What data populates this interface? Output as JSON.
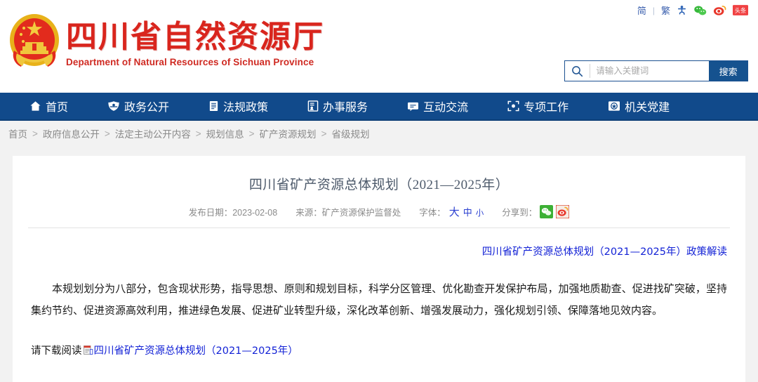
{
  "header": {
    "logo": {
      "emblem_icon": "china-national-emblem-icon",
      "title_cn": "四川省自然资源厅",
      "title_en": "Department of Natural Resources of Sichuan Province"
    },
    "utilities": [
      {
        "name": "lang-simplified",
        "label": "简"
      },
      {
        "name": "lang-separator",
        "label": "|"
      },
      {
        "name": "lang-traditional",
        "label": "繁"
      },
      {
        "name": "accessibility-icon",
        "label": ""
      },
      {
        "name": "wechat-icon",
        "label": ""
      },
      {
        "name": "weibo-icon",
        "label": ""
      },
      {
        "name": "toutiao-icon",
        "label": "头条"
      }
    ],
    "search": {
      "placeholder": "请输入关键词",
      "value": "",
      "button_label": "搜索",
      "icon": "search-icon"
    }
  },
  "nav": {
    "items": [
      {
        "label": "首页",
        "icon": "home-icon"
      },
      {
        "label": "政务公开",
        "icon": "shield-icon"
      },
      {
        "label": "法规政策",
        "icon": "document-icon"
      },
      {
        "label": "办事服务",
        "icon": "service-form-icon"
      },
      {
        "label": "互动交流",
        "icon": "chat-bubble-icon"
      },
      {
        "label": "专项工作",
        "icon": "target-frame-icon"
      },
      {
        "label": "机关党建",
        "icon": "party-badge-icon"
      }
    ]
  },
  "breadcrumb": {
    "separator": ">",
    "items": [
      "首页",
      "政府信息公开",
      "法定主动公开内容",
      "规划信息",
      "矿产资源规划",
      "省级规划"
    ]
  },
  "article": {
    "title": "四川省矿产资源总体规划（2021—2025年）",
    "meta": {
      "date_label": "发布日期：",
      "date_value": "2023-02-08",
      "source_label": "来源：",
      "source_value": "矿产资源保护监督处",
      "font_label": "字体：",
      "font_large": "大",
      "font_medium": "中",
      "font_small": "小",
      "share_label": "分享到：",
      "share_icons": [
        "wechat-share-icon",
        "weibo-share-icon"
      ]
    },
    "interpretation_link": "四川省矿产资源总体规划（2021—2025年）政策解读",
    "paragraph": "本规划划分为八部分，包含现状形势，指导思想、原则和规划目标，科学分区管理、优化勘查开发保护布局，加强地质勘查、促进找矿突破，坚持集约节约、促进资源高效利用，推进绿色发展、促进矿业转型升级，深化改革创新、增强发展动力，强化规划引领、保障落地见效内容。",
    "download": {
      "prefix": "请下载阅读",
      "file_icon": "file-document-icon",
      "link_text": "四川省矿产资源总体规划（2021—2025年）"
    }
  },
  "colors": {
    "nav_blue": "#114a8b",
    "brand_red": "#d9251d",
    "link_blue": "#1322d6",
    "page_bg": "#f2f2f2"
  }
}
